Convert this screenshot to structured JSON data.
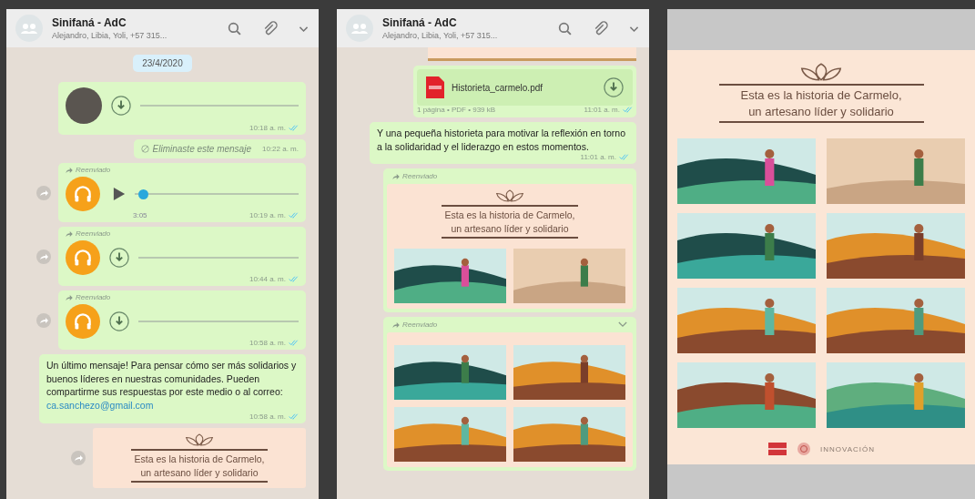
{
  "chats": [
    {
      "header": {
        "title": "Sinifaná - AdC",
        "subtitle": "Alejandro, Libia, Yoli, +57 315..."
      },
      "messages": [
        {
          "kind": "date",
          "text": "23/4/2020"
        },
        {
          "kind": "voice-photo",
          "time": "10:18 a. m.",
          "share": false
        },
        {
          "kind": "deleted",
          "text": "Eliminaste este mensaje",
          "time": "10:22 a. m."
        },
        {
          "kind": "voice-play",
          "label": "Reenviado",
          "level": 0.02,
          "duration": "3:05",
          "time": "10:19 a. m.",
          "share": true
        },
        {
          "kind": "voice",
          "label": "Reenviado",
          "time": "10:44 a. m.",
          "share": true
        },
        {
          "kind": "voice",
          "label": "Reenviado",
          "time": "10:58 a. m.",
          "share": true
        },
        {
          "kind": "text",
          "text": "Un último mensaje! Para pensar cómo ser más solidarios y buenos líderes en nuestras comunidades. Pueden compartirme sus respuestas por este medio o al correo: ",
          "link": "ca.sanchezo@gmail.com",
          "time": "10:58 a. m."
        },
        {
          "kind": "cover",
          "title_lines": [
            "Esta es la historia de Carmelo,",
            "un artesano líder y solidario"
          ],
          "share": true
        }
      ]
    },
    {
      "header": {
        "title": "Sinifaná - AdC",
        "subtitle": "Alejandro, Libia, Yoli, +57 315..."
      },
      "messages": [
        {
          "kind": "image-edge"
        },
        {
          "kind": "document",
          "file": "Historieta_carmelo.pdf",
          "meta": "1 página • PDF • 939 kB",
          "time": "11:01 a. m."
        },
        {
          "kind": "text",
          "text": "Y una pequeña historieta para motivar la reflexión en torno a la solidaridad y el liderazgo en estos momentos.",
          "time": "11:01 a. m."
        },
        {
          "kind": "cover",
          "label": "Reenviado",
          "title_lines": [
            "Esta es la historia de Carmelo,",
            "un artesano líder y solidario"
          ],
          "share": false
        },
        {
          "kind": "pages",
          "label": "Reenviado",
          "share": false
        }
      ]
    }
  ],
  "viewer": {
    "title_lines": [
      "Esta es la historia de Carmelo,",
      "un artesano líder y solidario"
    ],
    "logo_text": "INNOVACIÓN"
  }
}
